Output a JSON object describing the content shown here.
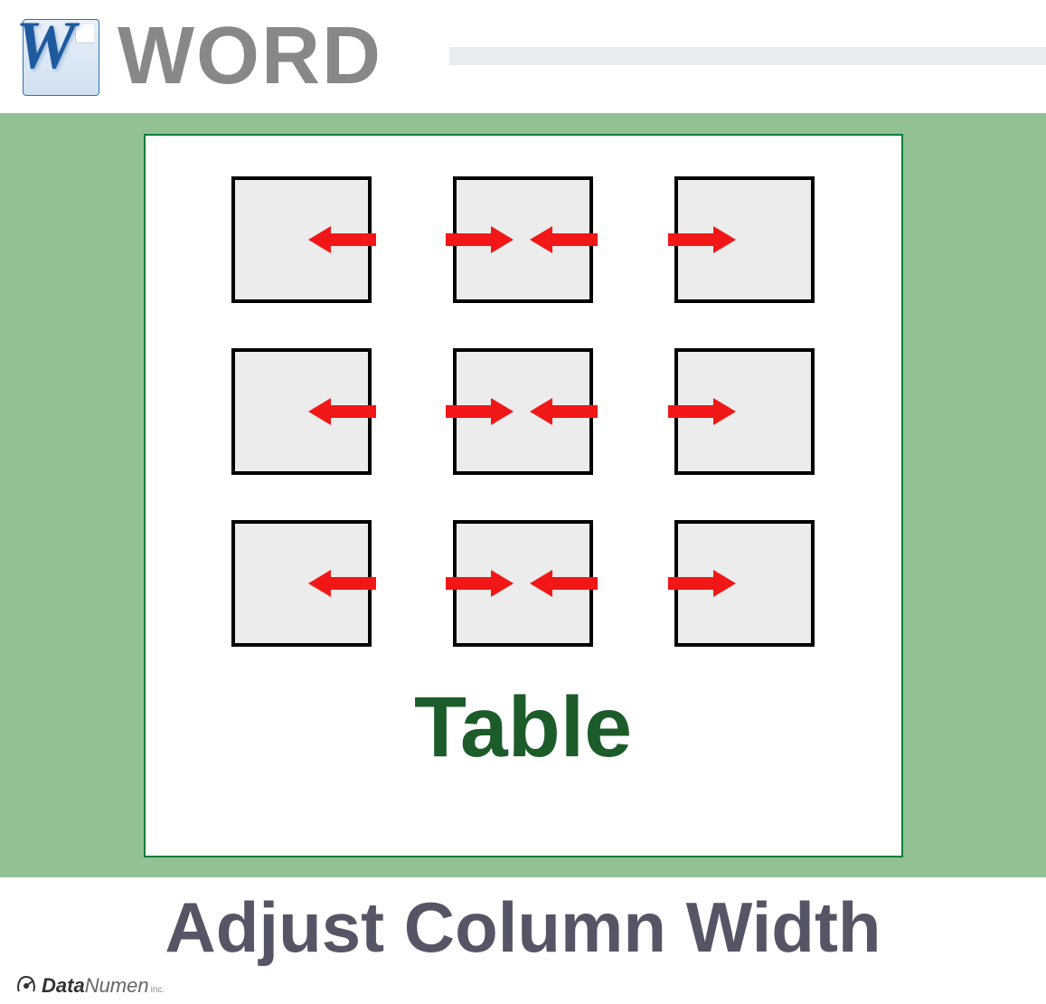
{
  "header": {
    "app_name": "WORD",
    "icon_letter": "W"
  },
  "panel": {
    "label": "Table"
  },
  "bottom": {
    "text": "Adjust Column Width"
  },
  "brand": {
    "prefix": "Data",
    "suffix": "Numen",
    "tag": "inc."
  }
}
